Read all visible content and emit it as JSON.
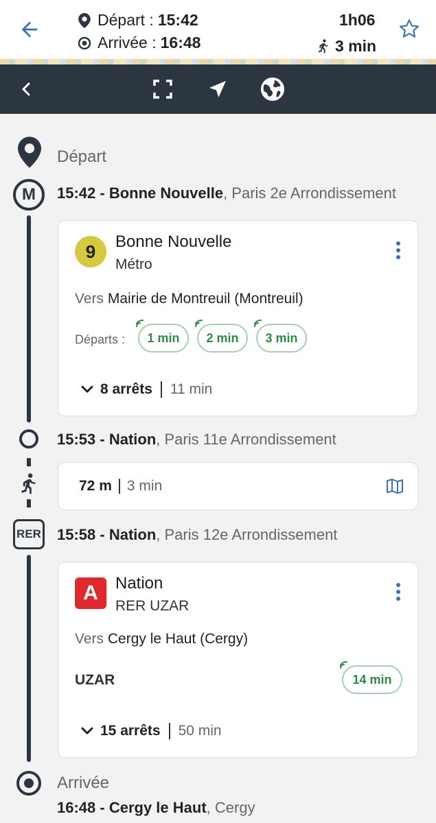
{
  "header": {
    "depart_label": "Départ :",
    "depart_time": "15:42",
    "arrivee_label": "Arrivée :",
    "arrivee_time": "16:48",
    "duration": "1h06",
    "walk_total": "3 min"
  },
  "timeline": {
    "origin_label": "Départ",
    "destination_label": "Arrivée",
    "stops": [
      {
        "time": "15:42 - ",
        "name": "Bonne Nouvelle",
        "city": ", Paris 2e Arrondissement"
      },
      {
        "time": "15:53 - ",
        "name": "Nation",
        "city": ", Paris 11e Arrondissement"
      },
      {
        "time": "15:58 - ",
        "name": "Nation",
        "city": ", Paris 12e Arrondissement"
      },
      {
        "time": "16:48 - ",
        "name": "Cergy le Haut",
        "city": ", Cergy"
      }
    ],
    "mode_icons": {
      "metro": "M",
      "rer": "RER"
    }
  },
  "legs": [
    {
      "line": "9",
      "title": "Bonne Nouvelle",
      "mode": "Métro",
      "vers": "Vers",
      "direction": "Mairie de Montreuil (Montreuil)",
      "departs_label": "Départs :",
      "departures": [
        "1 min",
        "2 min",
        "3 min"
      ],
      "stops_count": "8 arrêts",
      "duration": "11 min",
      "color": "#d6c940"
    },
    {
      "line": "A",
      "title": "Nation",
      "mode": "RER UZAR",
      "vers": "Vers",
      "direction": "Cergy le Haut (Cergy)",
      "mission": "UZAR",
      "departures": [
        "14 min"
      ],
      "stops_count": "15 arrêts",
      "duration": "50 min",
      "color": "#e0292c"
    }
  ],
  "walk": {
    "distance": "72 m",
    "duration": "3 min"
  },
  "colors": {
    "accent": "#3b6fb6",
    "realtime": "#2d8a45",
    "toolbar": "#2b3640"
  }
}
